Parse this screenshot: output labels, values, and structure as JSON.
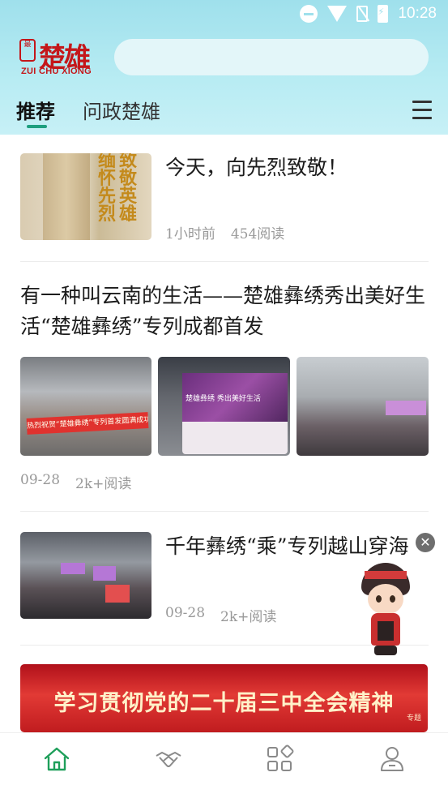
{
  "status_bar": {
    "time": "10:28"
  },
  "logo": {
    "cn": "楚雄",
    "en": "ZUI CHU XIONG",
    "seal": "最"
  },
  "search": {
    "placeholder": ""
  },
  "tabs": [
    {
      "label": "推荐",
      "active": true
    },
    {
      "label": "问政楚雄",
      "active": false
    }
  ],
  "articles": [
    {
      "title": "今天，向先烈致敬！",
      "time": "1小时前",
      "reads": "454阅读",
      "thumb_text": [
        "缅",
        "怀",
        "先",
        "烈",
        "致",
        "敬",
        "英",
        "雄"
      ]
    },
    {
      "title": "有一种叫云南的生活——楚雄彝绣秀出美好生活“楚雄彝绣”专列成都首发",
      "time": "09-28",
      "reads": "2k+阅读",
      "thumb_texts": [
        "热烈祝贺“楚雄彝绣”专列首发圆满成功!",
        "楚雄彝绣 秀出美好生活"
      ]
    },
    {
      "title": "千年彝绣“乘”专列越山穿海",
      "time": "09-28",
      "reads": "2k+阅读"
    }
  ],
  "promo": {
    "text": "学习贯彻党的二十届三中全会精神",
    "tag": "专题"
  },
  "floating": {
    "close": "✕"
  },
  "bottom_nav": [
    {
      "icon": "home-icon",
      "active": true,
      "color": "#1e9f5a"
    },
    {
      "icon": "handshake-icon",
      "active": false
    },
    {
      "icon": "apps-grid-icon",
      "active": false
    },
    {
      "icon": "profile-icon",
      "active": false
    }
  ],
  "colors": {
    "accent": "#1e9f7f",
    "brand_red": "#c4171a",
    "header_bg": "#9fe0ec"
  }
}
